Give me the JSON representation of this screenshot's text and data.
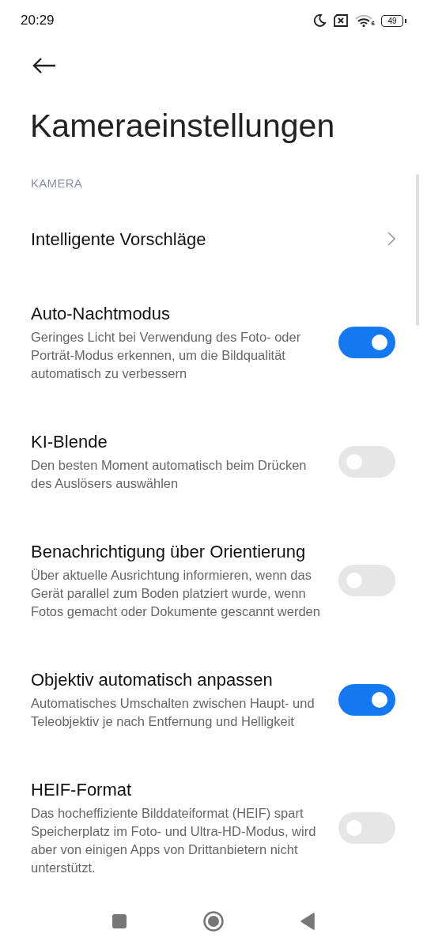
{
  "status_bar": {
    "time": "20:29",
    "network_label": "6",
    "battery": "49"
  },
  "title": "Kameraeinstellungen",
  "section": "KAMERA",
  "items": [
    {
      "kind": "link",
      "title": "Intelligente Vorschläge"
    },
    {
      "kind": "toggle",
      "title": "Auto-Nachtmodus",
      "description": "Geringes Licht bei Verwendung des Foto- oder Porträt-Modus erkennen, um die Bildqualität automatisch zu verbessern",
      "on": true
    },
    {
      "kind": "toggle",
      "title": "KI-Blende",
      "description": "Den besten Moment automatisch beim Drücken des Auslösers auswählen",
      "on": false
    },
    {
      "kind": "toggle",
      "title": "Benachrichtigung über Orientierung",
      "description": "Über aktuelle Ausrichtung informieren, wenn das Gerät parallel zum Boden platziert wurde, wenn Fotos gemacht oder Dokumente gescannt werden",
      "on": false
    },
    {
      "kind": "toggle",
      "title": "Objektiv automatisch anpassen",
      "description": "Automatisches Umschalten zwischen Haupt- und Teleobjektiv je nach Entfernung und Helligkeit",
      "on": true
    },
    {
      "kind": "toggle",
      "title": "HEIF-Format",
      "description": "Das hocheffiziente Bilddateiformat (HEIF) spart Speicherplatz im Foto- und Ultra-HD-Modus, wird aber von einigen Apps von Drittanbietern nicht unterstützt.",
      "on": false
    }
  ]
}
